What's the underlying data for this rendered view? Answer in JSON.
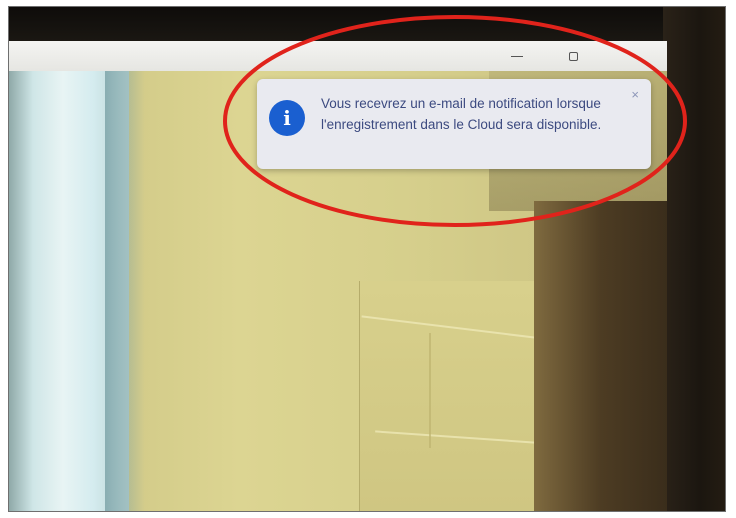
{
  "window": {
    "minimize_icon": "minimize-icon",
    "maximize_icon": "maximize-icon"
  },
  "notification": {
    "icon": "info-icon",
    "icon_glyph": "i",
    "message": "Vous recevrez un e-mail de notification lorsque l'enregistrement dans le Cloud sera disponible.",
    "close_glyph": "×",
    "accent_color": "#1a5fd0"
  },
  "annotation": {
    "shape": "ellipse",
    "color": "#e0231b"
  }
}
